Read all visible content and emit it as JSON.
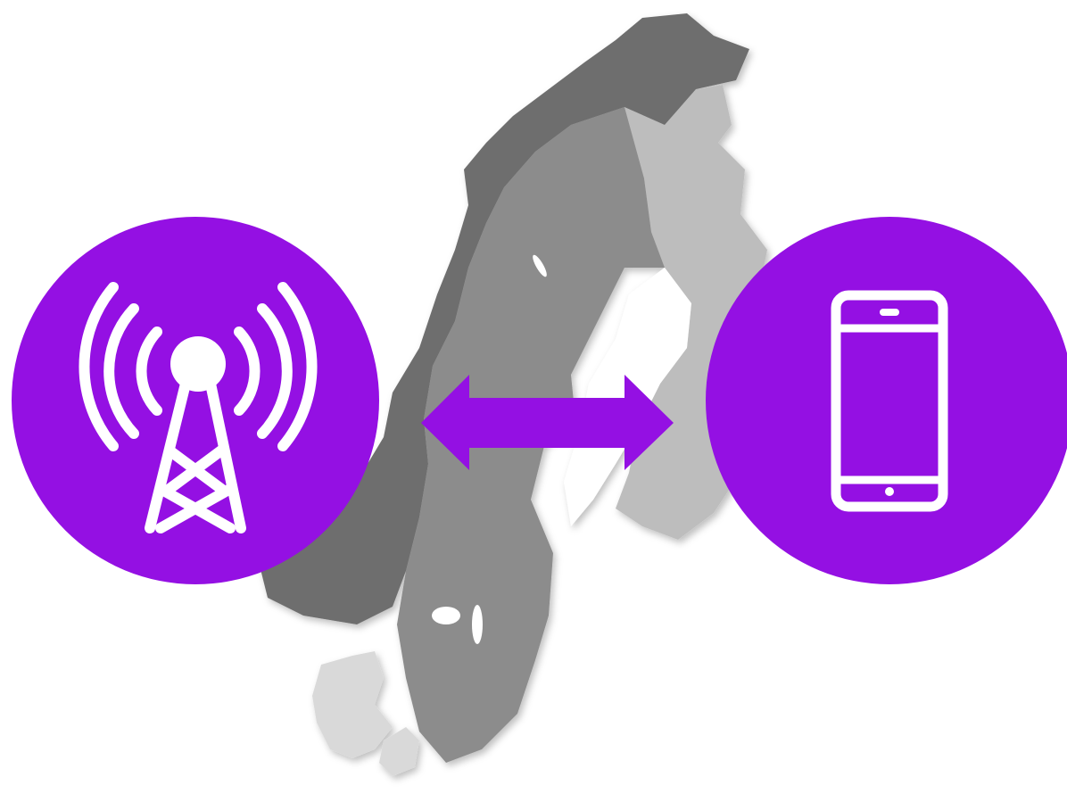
{
  "diagram": {
    "accent_color": "#9410E3",
    "icon_color": "#FFFFFF",
    "map": {
      "regions": [
        "norway",
        "sweden",
        "finland",
        "denmark"
      ],
      "colors": {
        "norway": "#6E6E6E",
        "sweden": "#8C8C8C",
        "finland": "#BDBDBD",
        "denmark": "#D9D9D9"
      }
    },
    "left_node": {
      "icon": "cell-tower-icon"
    },
    "connector": {
      "icon": "double-arrow-icon",
      "direction": "bidirectional"
    },
    "right_node": {
      "icon": "smartphone-icon"
    }
  }
}
